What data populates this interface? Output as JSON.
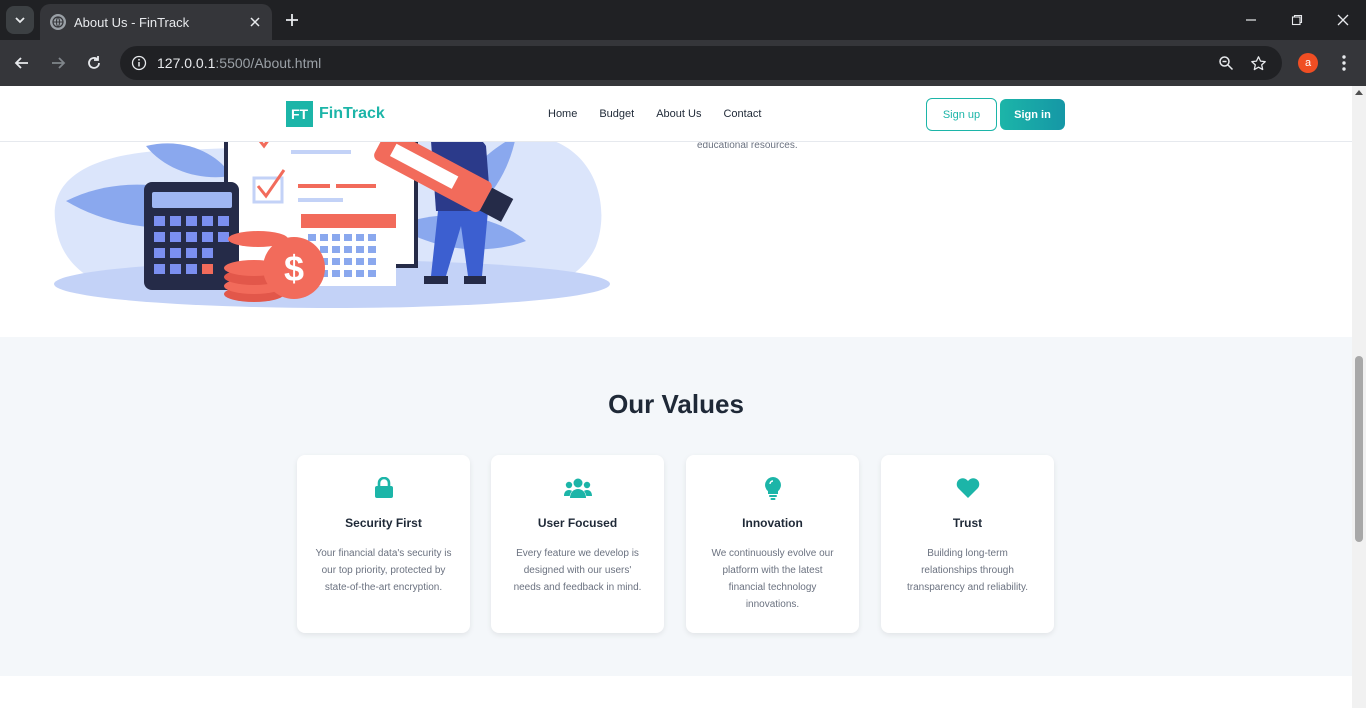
{
  "browser": {
    "tab_title": "About Us - FinTrack",
    "url_host": "127.0.0.1",
    "url_path": ":5500/About.html",
    "profile_initial": "a"
  },
  "nav": {
    "logo_mark": "FT",
    "logo_text": "FinTrack",
    "links": [
      "Home",
      "Budget",
      "About Us",
      "Contact"
    ],
    "signup_label": "Sign up",
    "signin_label": "Sign in"
  },
  "hero": {
    "text_fragment": "educational resources."
  },
  "values": {
    "title": "Our Values",
    "cards": [
      {
        "icon": "lock-icon",
        "title": "Security First",
        "desc": "Your financial data's security is our top priority, protected by state-of-the-art encryption."
      },
      {
        "icon": "users-icon",
        "title": "User Focused",
        "desc": "Every feature we develop is designed with our users' needs and feedback in mind."
      },
      {
        "icon": "lightbulb-icon",
        "title": "Innovation",
        "desc": "We continuously evolve our platform with the latest financial technology innovations."
      },
      {
        "icon": "heart-icon",
        "title": "Trust",
        "desc": "Building long-term relationships through transparency and reliability."
      }
    ]
  },
  "colors": {
    "brand": "#1cb5a8",
    "heading": "#1f2937",
    "body_text": "#6b7280",
    "section_bg": "#f4f7fa"
  }
}
